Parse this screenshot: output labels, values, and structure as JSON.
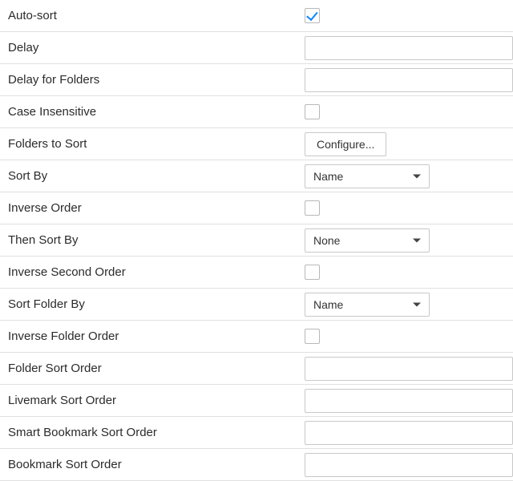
{
  "rows": {
    "auto_sort": {
      "label": "Auto-sort",
      "checked": true
    },
    "delay": {
      "label": "Delay",
      "value": ""
    },
    "delay_folders": {
      "label": "Delay for Folders",
      "value": ""
    },
    "case_insensitive": {
      "label": "Case Insensitive",
      "checked": false
    },
    "folders_to_sort": {
      "label": "Folders to Sort",
      "button": "Configure..."
    },
    "sort_by": {
      "label": "Sort By",
      "selected": "Name"
    },
    "inverse_order": {
      "label": "Inverse Order",
      "checked": false
    },
    "then_sort_by": {
      "label": "Then Sort By",
      "selected": "None"
    },
    "inverse_second_order": {
      "label": "Inverse Second Order",
      "checked": false
    },
    "sort_folder_by": {
      "label": "Sort Folder By",
      "selected": "Name"
    },
    "inverse_folder_order": {
      "label": "Inverse Folder Order",
      "checked": false
    },
    "folder_sort_order": {
      "label": "Folder Sort Order",
      "value": ""
    },
    "livemark_sort_order": {
      "label": "Livemark Sort Order",
      "value": ""
    },
    "smart_bookmark_sort_order": {
      "label": "Smart Bookmark Sort Order",
      "value": ""
    },
    "bookmark_sort_order": {
      "label": "Bookmark Sort Order",
      "value": ""
    }
  }
}
